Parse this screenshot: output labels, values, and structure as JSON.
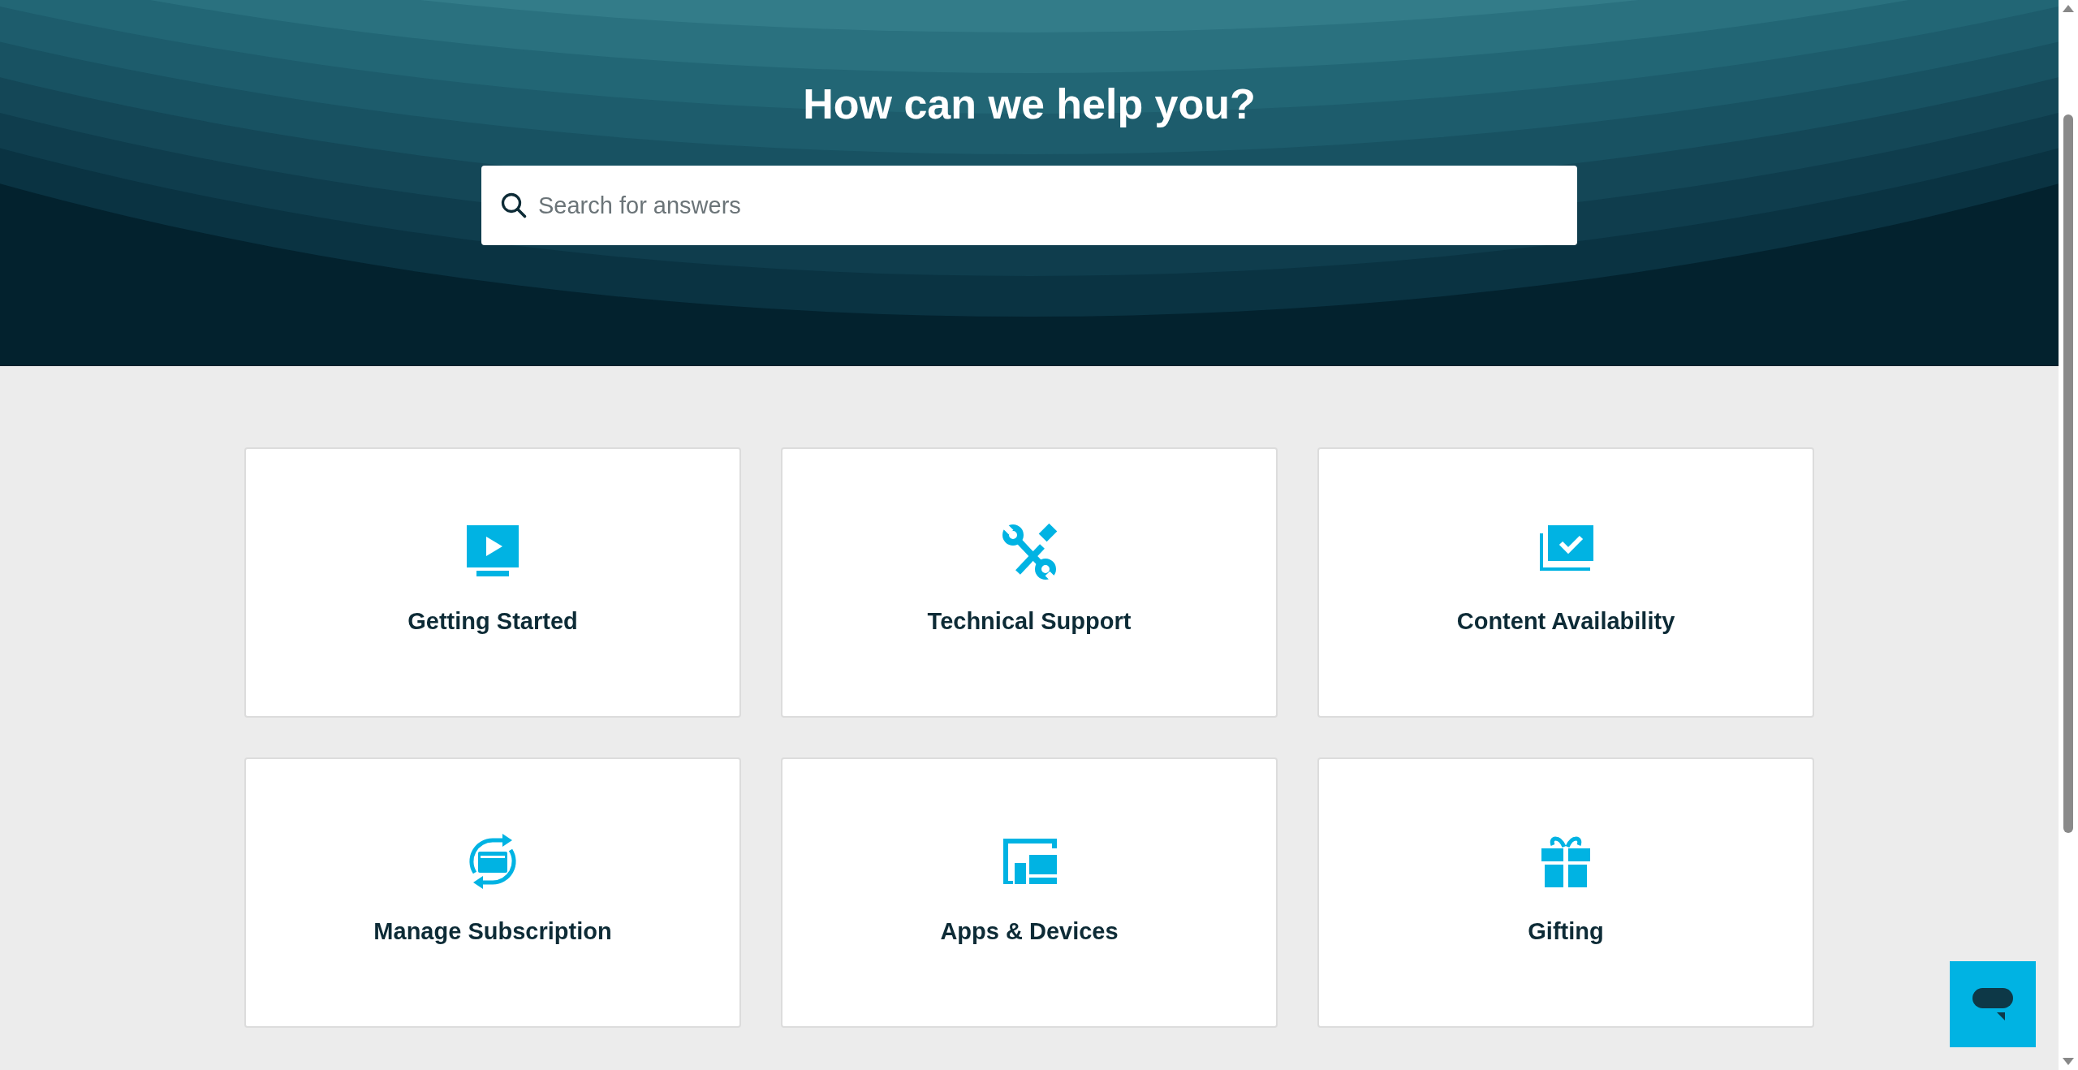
{
  "hero": {
    "title": "How can we help you?",
    "search": {
      "placeholder": "Search for answers"
    }
  },
  "categories": [
    {
      "label": "Getting Started"
    },
    {
      "label": "Technical Support"
    },
    {
      "label": "Content Availability"
    },
    {
      "label": "Manage Subscription"
    },
    {
      "label": "Apps & Devices"
    },
    {
      "label": "Gifting"
    }
  ]
}
